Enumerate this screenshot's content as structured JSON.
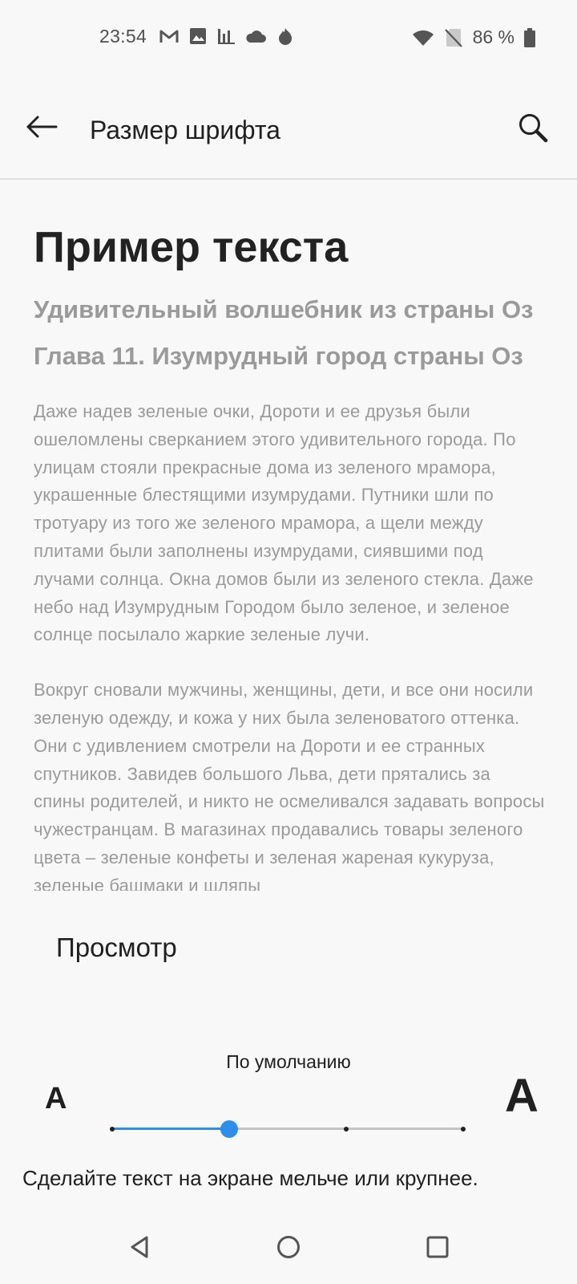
{
  "status_bar": {
    "time": "23:54",
    "left_icons": [
      "gmail-icon",
      "photos-icon",
      "chart-icon",
      "cloud-icon",
      "fire-icon"
    ],
    "right_icons": [
      "wifi-icon",
      "no-sim-icon",
      "battery-icon"
    ],
    "battery": "86 %"
  },
  "app_bar": {
    "title": "Размер шрифта"
  },
  "sample": {
    "title": "Пример текста",
    "subtitle": "Удивительный волшебник из страны Оз",
    "chapter": "Глава 11. Изумрудный город страны Оз",
    "paragraphs": [
      "Даже надев зеленые очки, Дороти и ее друзья были ошеломлены сверканием этого удивительного города. По улицам стояли прекрасные дома из зеленого мрамора, украшенные блестящими изумрудами. Путники шли по тротуару из того же зеленого мрамора, а щели между плитами были заполнены изумрудами, сиявшими под лучами солнца. Окна домов были из зеленого стекла. Даже небо над Изумрудным Городом было зеленое, и зеленое солнце посылало жаркие зеленые лучи.",
      "Вокруг сновали мужчины, женщины, дети, и все они носили зеленую одежду, и кожа у них была зеленоватого оттенка. Они с удивлением смотрели на Дороти и ее странных спутников. Завидев большого Льва, дети прятались за спины родителей, и никто не осмеливался задавать вопросы чужестранцам. В магазинах продавались товары зеленого цвета – зеленые конфеты и зеленая жареная кукуруза, зеленые башмаки и шляпы"
    ]
  },
  "preview": {
    "label": "Просмотр"
  },
  "font_slider": {
    "value_label": "По умолчанию",
    "small_label": "A",
    "large_label": "A",
    "steps": 4,
    "selected_index": 1,
    "accent_color": "#2f8ee8",
    "description": "Сделайте текст на экране мельче или крупнее."
  },
  "nav_bar": {
    "buttons": [
      "back-triangle-icon",
      "home-circle-icon",
      "recents-square-icon"
    ]
  }
}
